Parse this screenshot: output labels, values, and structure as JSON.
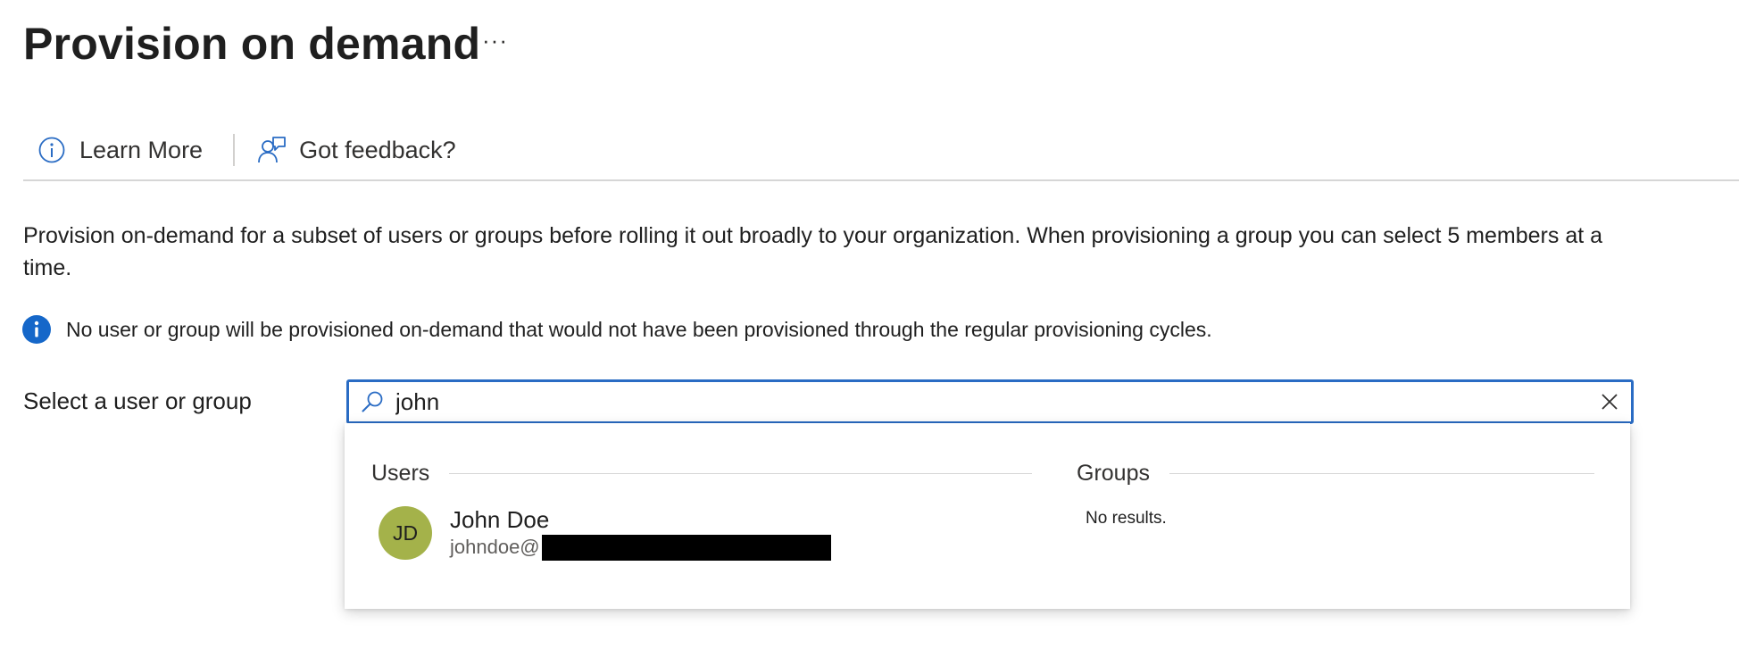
{
  "page": {
    "title": "Provision on demand",
    "more_label": "···"
  },
  "toolbar": {
    "learn_more": "Learn More",
    "feedback": "Got feedback?"
  },
  "description": "Provision on-demand for a subset of users or groups before rolling it out broadly to your organization. When provisioning a group you can select 5 members at a time.",
  "info": {
    "text": "No user or group will be provisioned on-demand that would not have been provisioned through the regular provisioning cycles."
  },
  "select": {
    "label": "Select a user or group",
    "search_value": "john"
  },
  "dropdown": {
    "users_header": "Users",
    "groups_header": "Groups",
    "users": [
      {
        "initials": "JD",
        "name": "John Doe",
        "email_prefix": "johndoe@",
        "avatar_color": "#a4b24a"
      }
    ],
    "groups_empty": "No results."
  },
  "colors": {
    "accent": "#2a6cc4",
    "info_blue": "#1567c9"
  },
  "icons": {
    "learn_more": "info-circle-outline-icon",
    "feedback": "feedback-person-icon",
    "info": "info-filled-icon",
    "search": "search-icon",
    "clear": "close-icon"
  }
}
